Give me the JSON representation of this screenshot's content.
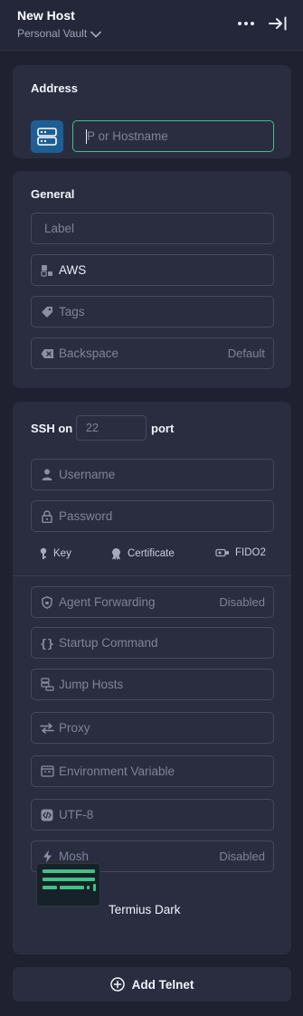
{
  "header": {
    "title": "New Host",
    "vault": "Personal Vault",
    "more_icon": "more-horizontal-icon",
    "collapse_icon": "collapse-panel-icon"
  },
  "address": {
    "title": "Address",
    "icon": "server-icon",
    "placeholder": "IP or Hostname",
    "visible_placeholder": "P or Hostname"
  },
  "general": {
    "title": "General",
    "label_placeholder": "Label",
    "group_value": "AWS",
    "tags_placeholder": "Tags",
    "backspace_label": "Backspace",
    "backspace_value": "Default"
  },
  "ssh": {
    "prefix": "SSH on",
    "port_placeholder": "22",
    "suffix": "port",
    "username_placeholder": "Username",
    "password_placeholder": "Password",
    "auth_methods": [
      "Key",
      "Certificate",
      "FIDO2"
    ],
    "options": [
      {
        "label": "Agent Forwarding",
        "value": "Disabled",
        "icon": "shield-icon"
      },
      {
        "label": "Startup Command",
        "value": "",
        "icon": "braces-icon"
      },
      {
        "label": "Jump Hosts",
        "value": "",
        "icon": "jump-hosts-icon"
      },
      {
        "label": "Proxy",
        "value": "",
        "icon": "arrows-swap-icon"
      },
      {
        "label": "Environment Variable",
        "value": "",
        "icon": "terminal-window-icon"
      },
      {
        "label": "UTF-8",
        "value": "",
        "icon": "code-icon"
      },
      {
        "label": "Mosh",
        "value": "Disabled",
        "icon": "lightning-icon"
      }
    ],
    "theme": "Termius Dark"
  },
  "footer": {
    "add_telnet": "Add Telnet"
  },
  "colors": {
    "background": "#1f2130",
    "card": "#2a2d40",
    "accent_green": "#3fc383",
    "server_icon_bg": "#1d5f94"
  }
}
